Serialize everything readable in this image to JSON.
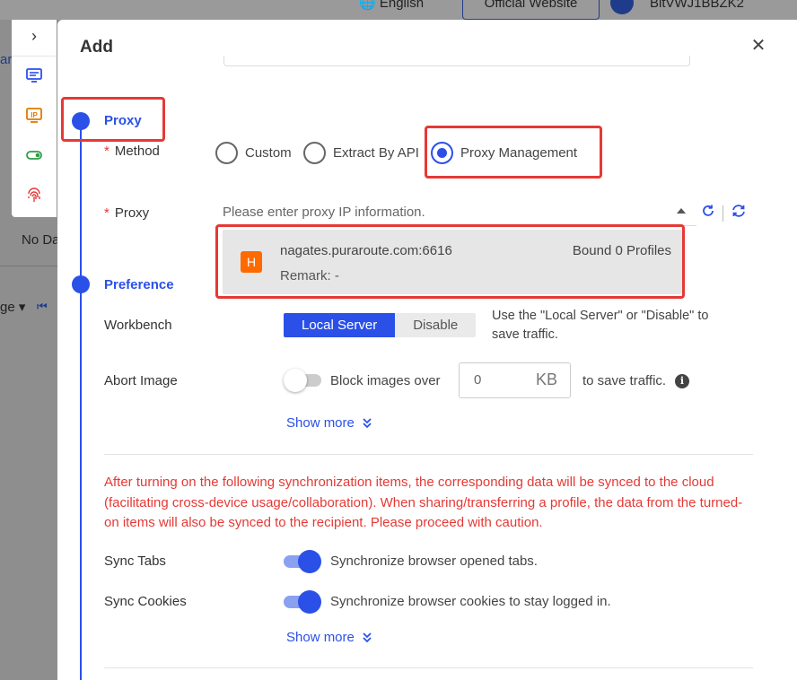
{
  "background": {
    "language": "English",
    "official_website": "Official Website",
    "user_id": "BitVWJ1BBZK2",
    "tab_fragment": "ar",
    "no_data": "No Da",
    "paging_fragment": "ge"
  },
  "modal": {
    "title": "Add",
    "close_icon": "close-icon",
    "sections": {
      "proxy_title": "Proxy",
      "preference_title": "Preference"
    },
    "method": {
      "label": "Method",
      "options": [
        "Custom",
        "Extract By API",
        "Proxy Management"
      ],
      "selected": "Proxy Management"
    },
    "proxy": {
      "label": "Proxy",
      "placeholder": "Please enter proxy IP information.",
      "dropdown": {
        "badge": "H",
        "host": "nagates.puraroute.com:6616",
        "remark": "Remark: -",
        "bound": "Bound 0 Profiles"
      }
    },
    "workbench": {
      "label": "Workbench",
      "options": [
        "Local Server",
        "Disable"
      ],
      "selected": "Local Server",
      "hint_line1": "Use the \"Local Server\" or \"Disable\" to",
      "hint_line2": "save traffic."
    },
    "abort_image": {
      "label": "Abort Image",
      "enabled": false,
      "prefix": "Block images over",
      "value": "0",
      "unit": "KB",
      "suffix": "to save traffic."
    },
    "show_more_label": "Show more",
    "sync_warning": "After turning on the following synchronization items, the corresponding data will be synced to the cloud (facilitating cross-device usage/collaboration). When sharing/transferring a profile, the data from the turned-on items will also be synced to the recipient. Please proceed with caution.",
    "sync_tabs": {
      "label": "Sync Tabs",
      "enabled": true,
      "description": "Synchronize browser opened tabs."
    },
    "sync_cookies": {
      "label": "Sync Cookies",
      "enabled": true,
      "description": "Synchronize browser cookies to stay logged in."
    }
  },
  "colors": {
    "accent": "#2b50e8",
    "warning": "#e53935",
    "badge": "#ff6a00"
  }
}
